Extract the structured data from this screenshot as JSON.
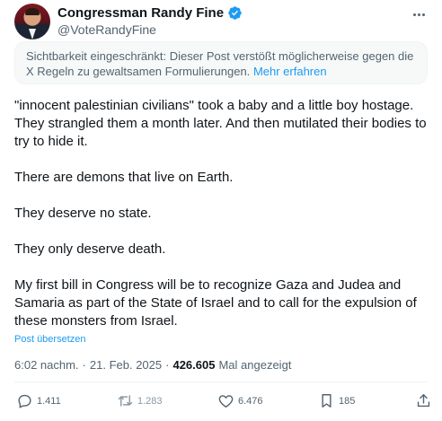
{
  "header": {
    "display_name": "Congressman Randy Fine",
    "handle": "@VoteRandyFine"
  },
  "notice": {
    "text": "Sichtbarkeit eingeschränkt: Dieser Post verstößt möglicherweise gegen die X Regeln zu gewaltsamen Formulierungen.",
    "link": "Mehr erfahren"
  },
  "tweet": {
    "paragraphs": [
      "\"innocent palestinian civilians\" took a baby and a little boy hostage. They strangled them a month later.  And then mutilated their bodies to try to hide it.",
      "There are demons that live on Earth.",
      "They deserve no state.",
      "They only deserve death.",
      "My first bill in Congress will be to recognize Gaza and Judea and Samaria as part of the State of Israel and to call for the expulsion of these monsters from Israel."
    ],
    "translate_label": "Post übersetzen"
  },
  "meta": {
    "time": "6:02 nachm.",
    "separator": "·",
    "date": "21. Feb. 2025",
    "views_count": "426.605",
    "views_label": "Mal angezeigt"
  },
  "actions": {
    "replies": "1.411",
    "reposts": "1.283",
    "likes": "6.476",
    "bookmarks": "185"
  },
  "icons": {
    "verified": "verified-badge-icon",
    "more": "more-options-icon",
    "reply": "reply-icon",
    "repost": "repost-icon",
    "like": "heart-icon",
    "views": "views-icon",
    "share": "share-icon"
  },
  "colors": {
    "accent": "#1d9bf0",
    "text": "#0f1419",
    "secondary": "#536471"
  }
}
